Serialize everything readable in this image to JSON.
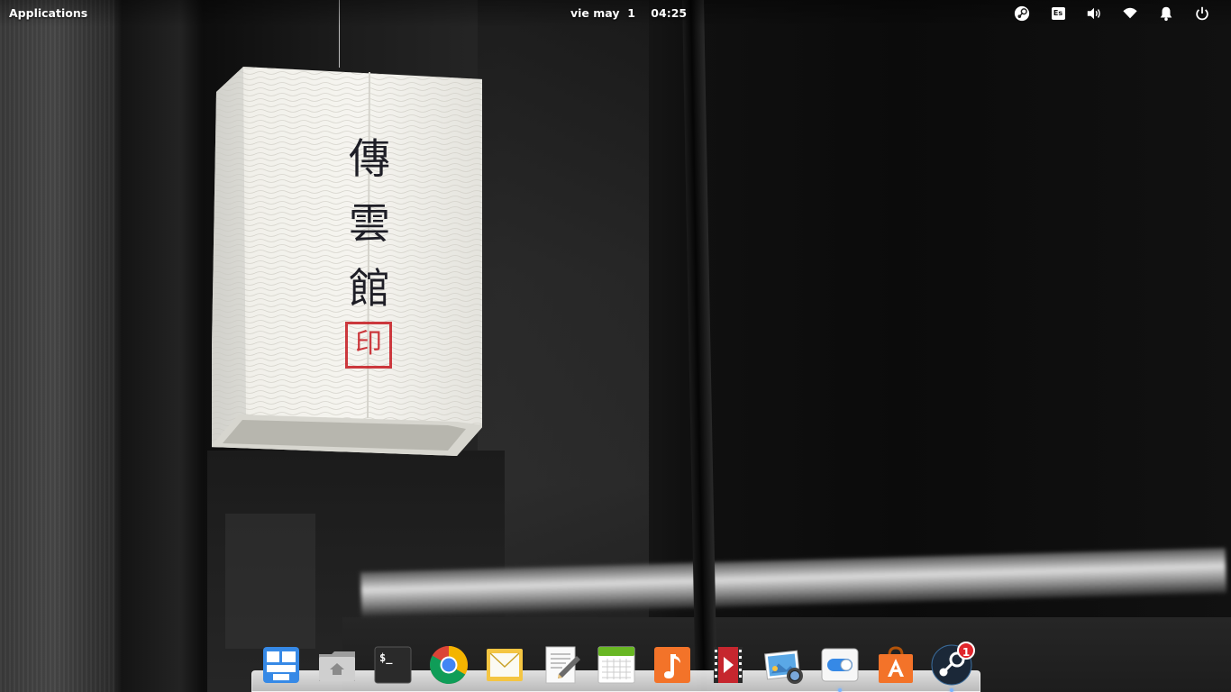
{
  "panel": {
    "applications_label": "Applications",
    "clock_text": "vie may  1    04:25",
    "indicators": [
      {
        "name": "steam-indicator",
        "icon": "steam-icon"
      },
      {
        "name": "keyboard-layout-indicator",
        "icon": "keyboard-icon",
        "label": "Es"
      },
      {
        "name": "sound-indicator",
        "icon": "volume-icon"
      },
      {
        "name": "network-indicator",
        "icon": "wifi-icon"
      },
      {
        "name": "notifications-indicator",
        "icon": "bell-icon"
      },
      {
        "name": "session-indicator",
        "icon": "power-icon"
      }
    ]
  },
  "wallpaper": {
    "lantern_characters": [
      "傳",
      "雲",
      "館"
    ],
    "seal_character": "印"
  },
  "dock": {
    "items": [
      {
        "name": "multitasking-view",
        "icon": "multitasking-icon"
      },
      {
        "name": "files",
        "icon": "folder-home-icon"
      },
      {
        "name": "terminal",
        "icon": "terminal-icon",
        "label": "$_"
      },
      {
        "name": "chrome",
        "icon": "chrome-icon"
      },
      {
        "name": "mail",
        "icon": "mail-icon"
      },
      {
        "name": "scratch-text-editor",
        "icon": "text-editor-icon"
      },
      {
        "name": "calendar",
        "icon": "calendar-icon"
      },
      {
        "name": "music",
        "icon": "music-note-icon"
      },
      {
        "name": "videos",
        "icon": "video-icon"
      },
      {
        "name": "photos",
        "icon": "photos-icon"
      },
      {
        "name": "system-settings",
        "icon": "toggle-switch-icon",
        "running": true
      },
      {
        "name": "app-center",
        "icon": "shopping-bag-icon"
      },
      {
        "name": "steam",
        "icon": "steam-icon",
        "badge": "1",
        "running": true
      }
    ]
  },
  "colors": {
    "accent": "#3689e6",
    "badge": "#e0252b",
    "seal": "#c8252b"
  }
}
